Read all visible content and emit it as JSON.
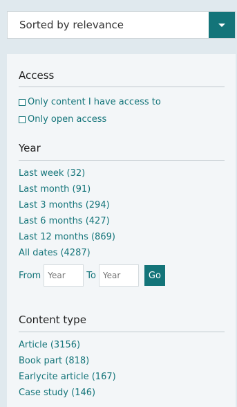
{
  "sort": {
    "label": "Sorted by relevance"
  },
  "access": {
    "heading": "Access",
    "options": [
      "Only content I have access to",
      "Only open access"
    ]
  },
  "year": {
    "heading": "Year",
    "options": [
      "Last week (32)",
      "Last month (91)",
      "Last 3 months (294)",
      "Last 6 months (427)",
      "Last 12 months (869)",
      "All dates (4287)"
    ],
    "from_label": "From",
    "to_label": "To",
    "from_placeholder": "Year",
    "to_placeholder": "Year",
    "go_label": "Go"
  },
  "content_type": {
    "heading": "Content type",
    "options": [
      "Article (3156)",
      "Book part (818)",
      "Earlycite article (167)",
      "Case study (146)"
    ]
  },
  "colors": {
    "accent": "#137479",
    "background": "#e0e9ee",
    "panel": "#f3f6f8"
  }
}
